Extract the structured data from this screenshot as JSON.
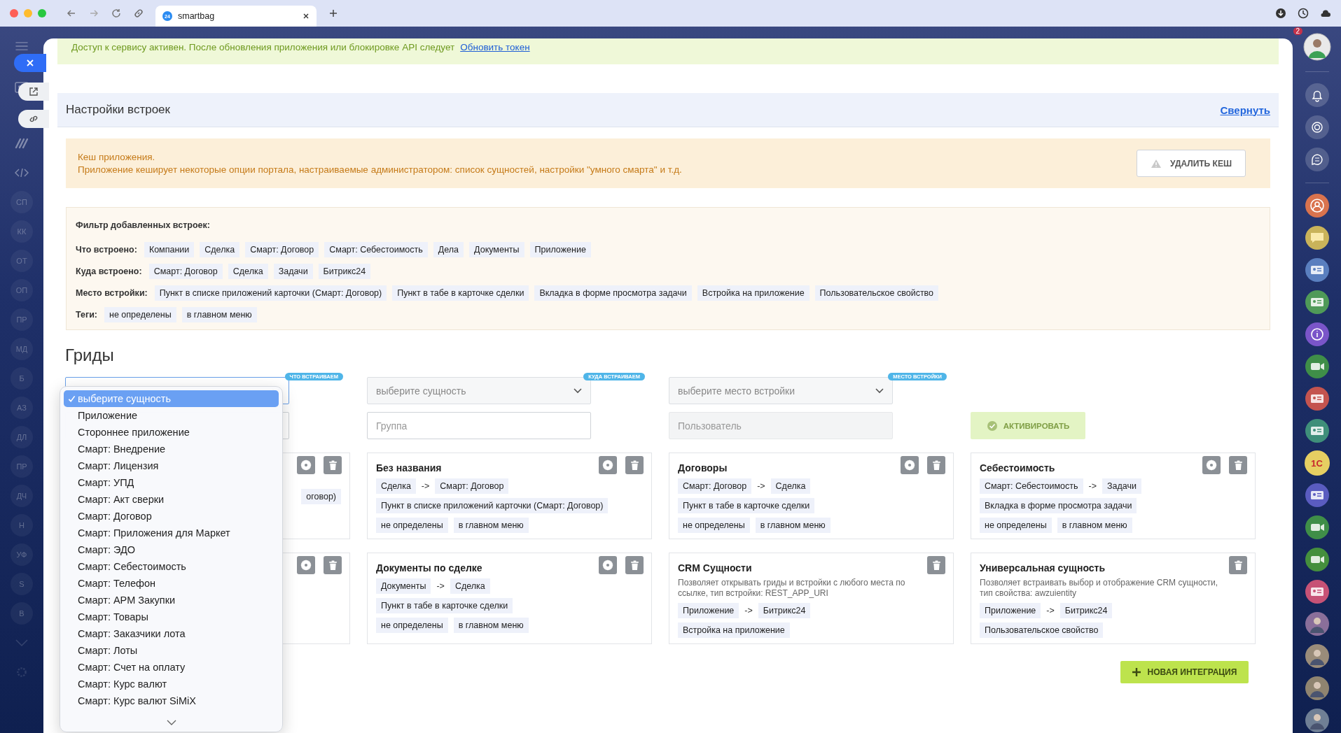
{
  "browser": {
    "tab_title": "smartbag",
    "favicon_text": "24"
  },
  "left_sidebar": {
    "items": [
      "СП",
      "КК",
      "ОТ",
      "ОП",
      "ПР",
      "МД",
      "Б",
      "АЗ",
      "ДЛ",
      "ПР",
      "ДЧ",
      "Н",
      "УФ",
      "S",
      "В"
    ]
  },
  "right_sidebar": {
    "notification_count": "2",
    "apps": [
      {
        "kind": "person",
        "color": "#d9734e"
      },
      {
        "kind": "chat",
        "color": "#c9b35a"
      },
      {
        "kind": "card",
        "color": "#5a7fbf"
      },
      {
        "kind": "card",
        "color": "#4f9a58"
      },
      {
        "kind": "info",
        "color": "#7a55c9"
      },
      {
        "kind": "video",
        "color": "#3f8e48"
      },
      {
        "kind": "card",
        "color": "#c4544f"
      },
      {
        "kind": "card",
        "color": "#3f8f7a"
      },
      {
        "kind": "logo",
        "color": "#e6cf62",
        "label": "1С"
      },
      {
        "kind": "card",
        "color": "#5a5cc0"
      },
      {
        "kind": "video",
        "color": "#3f8e48"
      },
      {
        "kind": "video",
        "color": "#458f3d"
      },
      {
        "kind": "card",
        "color": "#c75276"
      },
      {
        "kind": "photo",
        "color": "#8a6f9a"
      },
      {
        "kind": "photo",
        "color": "#9a8c7a"
      },
      {
        "kind": "photo",
        "color": "#8f8470"
      },
      {
        "kind": "photo",
        "color": "#6f7f95"
      }
    ]
  },
  "access_notice": {
    "text": "Доступ к сервису активен. После обновления приложения или блокировке API следует",
    "link": "Обновить токен"
  },
  "settings": {
    "title": "Настройки встроек",
    "collapse_link": "Свернуть"
  },
  "cache": {
    "title": "Кеш приложения.",
    "text": "Приложение кеширует некоторые опции портала, настраиваемые администратором: список сущностей, настройки \"умного смарта\" и т.д.",
    "button": "УДАЛИТЬ КЕШ"
  },
  "filter": {
    "title": "Фильтр добавленных встроек:",
    "rows": [
      {
        "label": "Что встроено:",
        "chips": [
          "Компании",
          "Сделка",
          "Смарт: Договор",
          "Смарт: Себестоимость",
          "Дела",
          "Документы",
          "Приложение"
        ]
      },
      {
        "label": "Куда встроено:",
        "chips": [
          "Смарт: Договор",
          "Сделка",
          "Задачи",
          "Битрикс24"
        ]
      },
      {
        "label": "Место встройки:",
        "chips": [
          "Пункт в списке приложений карточки (Смарт: Договор)",
          "Пункт в табе в карточке сделки",
          "Вкладка в форме просмотра задачи",
          "Встройка на приложение",
          "Пользовательское свойство"
        ]
      },
      {
        "label": "Теги:",
        "chips": [
          "не определены",
          "в главном меню"
        ]
      }
    ]
  },
  "grids": {
    "title": "Гриды",
    "selects": [
      {
        "badge": "ЧТО ВСТРАИВАЕМ",
        "focused": true
      },
      {
        "badge": "КУДА ВСТРАИВАЕМ",
        "value": "выберите сущность",
        "focused": false
      },
      {
        "badge": "МЕСТО ВСТРОЙКИ",
        "value": "выберите место встройки",
        "focused": false
      }
    ],
    "inputs": [
      {
        "disabled": false
      },
      {
        "placeholder": "Группа",
        "disabled": false
      },
      {
        "placeholder": "Пользователь",
        "disabled": true
      }
    ],
    "activate_button": {
      "label": "АКТИВИРОВАТЬ",
      "disabled": true
    },
    "cards": [
      {
        "kind": "covered",
        "settings": true,
        "visible_chip": "оговор)"
      },
      {
        "kind": "link",
        "settings": true,
        "title": "Без названия",
        "from": "Сделка",
        "arrow": "->",
        "to": "Смарт: Договор",
        "place": "Пункт в списке приложений карточки (Смарт: Договор)",
        "tags": [
          "не определены",
          "в главном меню"
        ]
      },
      {
        "kind": "link",
        "settings": true,
        "title": "Договоры",
        "from": "Смарт: Договор",
        "arrow": "->",
        "to": "Сделка",
        "place": "Пункт в табе в карточке сделки",
        "tags": [
          "не определены",
          "в главном меню"
        ]
      },
      {
        "kind": "link",
        "settings": true,
        "title": "Себестоимость",
        "from": "Смарт: Себестоимость",
        "arrow": "->",
        "to": "Задачи",
        "place": "Вкладка в форме просмотра задачи",
        "tags": [
          "не определены",
          "в главном меню"
        ]
      },
      {
        "kind": "covered",
        "settings": true
      },
      {
        "kind": "link",
        "settings": true,
        "title": "Документы по сделке",
        "from": "Документы",
        "arrow": "->",
        "to": "Сделка",
        "place": "Пункт в табе в карточке сделки",
        "tags": [
          "не определены",
          "в главном меню"
        ]
      },
      {
        "kind": "link",
        "settings": false,
        "title": "CRM Сущности",
        "description": "Позволяет открывать гриды и встройки с любого места по ссылке, тип встройки: REST_APP_URI",
        "from": "Приложение",
        "arrow": "->",
        "to": "Битрикс24",
        "place": "Встройка на приложение"
      },
      {
        "kind": "link",
        "settings": false,
        "title": "Универсальная сущность",
        "description": "Позволяет встраивать выбор и отображение CRM сущности, тип свойства: awzuientity",
        "from": "Приложение",
        "arrow": "->",
        "to": "Битрикс24",
        "place": "Пользовательское свойство"
      }
    ],
    "new_button": "НОВАЯ ИНТЕГРАЦИЯ",
    "dropdown": {
      "options": [
        {
          "label": "выберите сущность",
          "selected": true
        },
        {
          "label": "Приложение",
          "selected": false
        },
        {
          "label": "Стороннее приложение",
          "selected": false
        },
        {
          "label": "Смарт: Внедрение",
          "selected": false
        },
        {
          "label": "Смарт: Лицензия",
          "selected": false
        },
        {
          "label": "Смарт: УПД",
          "selected": false
        },
        {
          "label": "Смарт: Акт сверки",
          "selected": false
        },
        {
          "label": "Смарт: Договор",
          "selected": false
        },
        {
          "label": "Смарт: Приложения для Маркет",
          "selected": false
        },
        {
          "label": "Смарт: ЭДО",
          "selected": false
        },
        {
          "label": "Смарт: Себестоимость",
          "selected": false
        },
        {
          "label": "Смарт: Телефон",
          "selected": false
        },
        {
          "label": "Смарт: АРМ Закупки",
          "selected": false
        },
        {
          "label": "Смарт: Товары",
          "selected": false
        },
        {
          "label": "Смарт: Заказчики лота",
          "selected": false
        },
        {
          "label": "Смарт: Лоты",
          "selected": false
        },
        {
          "label": "Смарт: Счет на оплату",
          "selected": false
        },
        {
          "label": "Смарт: Курс валют",
          "selected": false
        },
        {
          "label": "Смарт: Курс валют SiMiX",
          "selected": false
        }
      ]
    }
  }
}
